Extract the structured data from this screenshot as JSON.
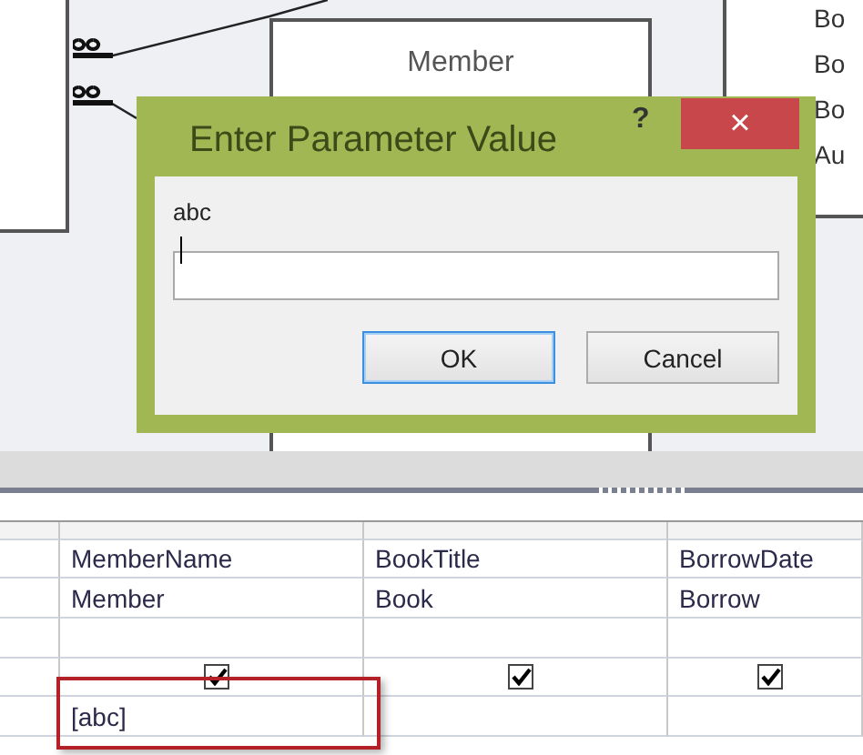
{
  "diagram": {
    "member_table": {
      "title": "Member"
    },
    "right_table": {
      "fields": [
        "Bo",
        "Bo",
        "Bo",
        "Au"
      ]
    }
  },
  "dialog": {
    "title": "Enter Parameter Value",
    "help": "?",
    "close": "×",
    "prompt": "abc",
    "input": {
      "focused": true
    },
    "buttons": [
      {
        "label": "OK",
        "default": true
      },
      {
        "label": "Cancel",
        "default": false
      }
    ]
  },
  "grid": {
    "columns": [
      {
        "field": "MemberName",
        "table": "Member",
        "show": true,
        "criteria": "[abc]",
        "highlighted": true
      },
      {
        "field": "BookTitle",
        "table": "Book",
        "show": true,
        "highlighted": false
      },
      {
        "field": "BorrowDate",
        "table": "Borrow",
        "show": true,
        "highlighted": false
      }
    ]
  }
}
